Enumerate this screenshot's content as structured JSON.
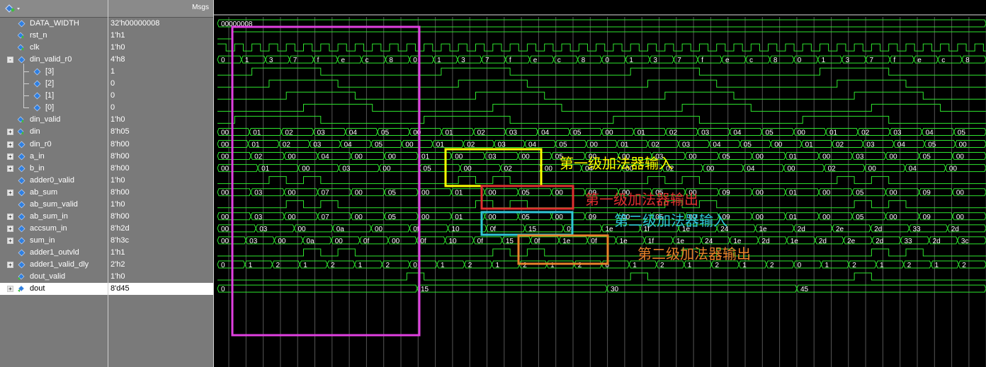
{
  "header": {
    "msgs_label": "Msgs"
  },
  "signals": [
    {
      "name": "DATA_WIDTH",
      "value": "32'h00000008",
      "expand": "",
      "level": 0,
      "icon": "param-icon"
    },
    {
      "name": "rst_n",
      "value": "1'h1",
      "expand": "",
      "level": 0,
      "icon": "input-wire-icon"
    },
    {
      "name": "clk",
      "value": "1'h0",
      "expand": "",
      "level": 0,
      "icon": "input-wire-icon"
    },
    {
      "name": "din_valid_r0",
      "value": "4'h8",
      "expand": "-",
      "level": 0,
      "icon": "signal-icon"
    },
    {
      "name": "[3]",
      "value": "1",
      "expand": "",
      "level": 1,
      "icon": "signal-icon"
    },
    {
      "name": "[2]",
      "value": "0",
      "expand": "",
      "level": 1,
      "icon": "signal-icon"
    },
    {
      "name": "[1]",
      "value": "0",
      "expand": "",
      "level": 1,
      "icon": "signal-icon"
    },
    {
      "name": "[0]",
      "value": "0",
      "expand": "",
      "level": 1,
      "icon": "signal-icon"
    },
    {
      "name": "din_valid",
      "value": "1'h0",
      "expand": "",
      "level": 0,
      "icon": "input-wire-icon"
    },
    {
      "name": "din",
      "value": "8'h05",
      "expand": "+",
      "level": 0,
      "icon": "input-wire-icon"
    },
    {
      "name": "din_r0",
      "value": "8'h00",
      "expand": "+",
      "level": 0,
      "icon": "signal-icon"
    },
    {
      "name": "a_in",
      "value": "8'h00",
      "expand": "+",
      "level": 0,
      "icon": "signal-icon"
    },
    {
      "name": "b_in",
      "value": "8'h00",
      "expand": "+",
      "level": 0,
      "icon": "signal-icon"
    },
    {
      "name": "adder0_valid",
      "value": "1'h0",
      "expand": "",
      "level": 0,
      "icon": "signal-icon"
    },
    {
      "name": "ab_sum",
      "value": "8'h00",
      "expand": "+",
      "level": 0,
      "icon": "signal-icon"
    },
    {
      "name": "ab_sum_valid",
      "value": "1'h0",
      "expand": "",
      "level": 0,
      "icon": "signal-icon"
    },
    {
      "name": "ab_sum_in",
      "value": "8'h00",
      "expand": "+",
      "level": 0,
      "icon": "signal-icon"
    },
    {
      "name": "accsum_in",
      "value": "8'h2d",
      "expand": "+",
      "level": 0,
      "icon": "signal-icon"
    },
    {
      "name": "sum_in",
      "value": "8'h3c",
      "expand": "+",
      "level": 0,
      "icon": "signal-icon"
    },
    {
      "name": "adder1_outvld",
      "value": "1'h1",
      "expand": "",
      "level": 0,
      "icon": "signal-icon"
    },
    {
      "name": "adder1_valid_dly",
      "value": "2'h2",
      "expand": "+",
      "level": 0,
      "icon": "signal-icon"
    },
    {
      "name": "dout_valid",
      "value": "1'h0",
      "expand": "",
      "level": 0,
      "icon": "output-icon"
    },
    {
      "name": "dout",
      "value": "8'd45",
      "expand": "+",
      "level": 0,
      "icon": "output-icon",
      "selected": true
    }
  ],
  "waves": {
    "DATA_WIDTH": [
      "00000008"
    ],
    "din_valid_r0": [
      "0",
      "1",
      "3",
      "7",
      "f",
      "e",
      "c",
      "8",
      "0",
      "1",
      "3",
      "7",
      "f",
      "e",
      "c",
      "8",
      "0",
      "1",
      "3",
      "7",
      "f",
      "e",
      "c",
      "8",
      "0",
      "1",
      "3",
      "7",
      "f",
      "e",
      "c",
      "8"
    ],
    "din": [
      "00",
      "01",
      "02",
      "03",
      "04",
      "05",
      "00",
      "01",
      "02",
      "03",
      "04",
      "05",
      "00",
      "01",
      "02",
      "03",
      "04",
      "05",
      "00",
      "01",
      "02",
      "03",
      "04",
      "05"
    ],
    "din_r0": [
      "00",
      "01",
      "02",
      "03",
      "04",
      "05",
      "00",
      "01",
      "02",
      "03",
      "04",
      "05",
      "00",
      "01",
      "02",
      "03",
      "04",
      "05",
      "00",
      "01",
      "02",
      "03",
      "04",
      "05",
      "00"
    ],
    "a_in": [
      "00",
      "02",
      "00",
      "04",
      "00",
      "00",
      "01",
      "00",
      "03",
      "00",
      "05",
      "00",
      "00",
      "03",
      "00",
      "05",
      "00",
      "01",
      "00",
      "03",
      "00",
      "05",
      "00"
    ],
    "b_in": [
      "00",
      "01",
      "00",
      "03",
      "00",
      "05",
      "00",
      "02",
      "00",
      "04",
      "00",
      "02",
      "00",
      "04",
      "00",
      "02",
      "00",
      "04",
      "00"
    ],
    "ab_sum": [
      "00",
      "03",
      "00",
      "07",
      "00",
      "05",
      "00",
      "01",
      "00",
      "05",
      "00",
      "09",
      "00",
      "05",
      "00",
      "09",
      "00",
      "01",
      "00",
      "05",
      "00",
      "09",
      "00"
    ],
    "ab_sum_in": [
      "00",
      "03",
      "00",
      "07",
      "00",
      "05",
      "00",
      "01",
      "00",
      "05",
      "00",
      "09",
      "00",
      "05",
      "00",
      "09",
      "00",
      "01",
      "00",
      "05",
      "00",
      "09",
      "00"
    ],
    "accsum_in": [
      "00",
      "03",
      "00",
      "0a",
      "00",
      "0f",
      "10",
      "0f",
      "15",
      "0f",
      "1e",
      "1f",
      "1e",
      "24",
      "1e",
      "2d",
      "2e",
      "2d",
      "33",
      "2d"
    ],
    "sum_in": [
      "00",
      "03",
      "00",
      "0a",
      "00",
      "0f",
      "00",
      "0f",
      "10",
      "0f",
      "15",
      "0f",
      "1e",
      "0f",
      "1e",
      "1f",
      "1e",
      "24",
      "1e",
      "2d",
      "1e",
      "2d",
      "2e",
      "2d",
      "33",
      "2d",
      "3c"
    ],
    "adder1_valid_dly": [
      "0",
      "1",
      "2",
      "1",
      "2",
      "1",
      "2",
      "0",
      "1",
      "2",
      "1",
      "2",
      "1",
      "2",
      "0",
      "1",
      "2",
      "1",
      "2",
      "1",
      "2",
      "0",
      "1",
      "2",
      "1",
      "2",
      "1",
      "2"
    ],
    "dout": [
      "0",
      "15",
      "30",
      "45"
    ]
  },
  "annotations": [
    {
      "label": "第一级加法器输入",
      "color": "#ffff00"
    },
    {
      "label": "第一级加法器输出",
      "color": "#e03030"
    },
    {
      "label": "第二级加法器输入",
      "color": "#30c8d8"
    },
    {
      "label": "第二级加法器输出",
      "color": "#e8822a"
    }
  ],
  "overlay_box_color": "#e040e0"
}
